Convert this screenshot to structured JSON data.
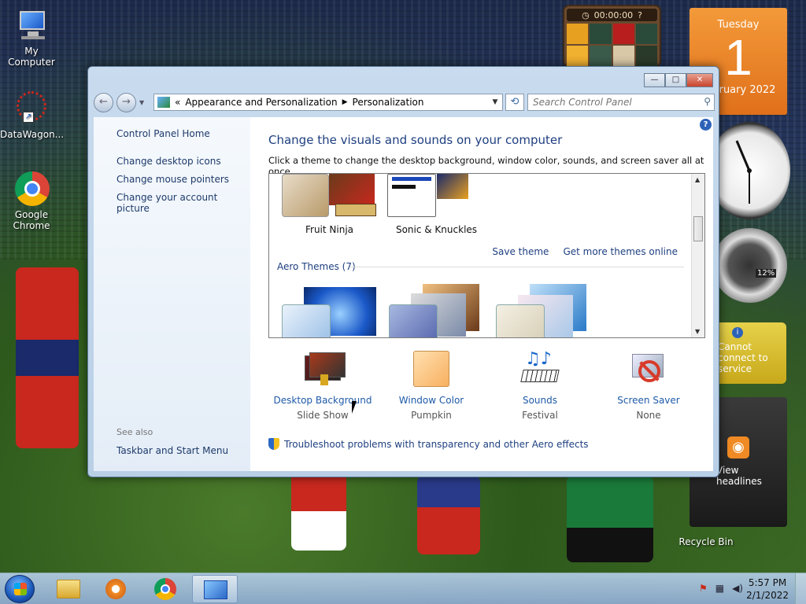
{
  "desktop": {
    "icons": [
      {
        "label": "My Computer"
      },
      {
        "label": "DataWagon..."
      },
      {
        "label": "Google Chrome"
      },
      {
        "label": "Recycle Bin"
      }
    ]
  },
  "gadgets": {
    "puzzle_timer": "00:00:00",
    "calendar": {
      "weekday": "Tuesday",
      "day": "1",
      "month_year": "February 2022"
    },
    "cpu_meter": {
      "value": "12%"
    },
    "weather": {
      "message": "Cannot connect to service"
    },
    "feed": {
      "label": "View headlines"
    }
  },
  "window": {
    "breadcrumb": [
      "Appearance and Personalization",
      "Personalization"
    ],
    "search_placeholder": "Search Control Panel",
    "sidebar": {
      "home": "Control Panel Home",
      "links": [
        "Change desktop icons",
        "Change mouse pointers",
        "Change your account picture"
      ],
      "see_also": "See also",
      "see_also_links": [
        "Taskbar and Start Menu"
      ]
    },
    "title": "Change the visuals and sounds on your computer",
    "description": "Click a theme to change the desktop background, window color, sounds, and screen saver all at once.",
    "themes": {
      "my_themes": [
        {
          "name": "Fruit Ninja"
        },
        {
          "name": "Sonic & Knuckles"
        }
      ],
      "save_theme": "Save theme",
      "get_more": "Get more themes online",
      "aero_header": "Aero Themes (7)"
    },
    "settings": [
      {
        "label": "Desktop Background",
        "value": "Slide Show",
        "icon": "desktop-background-icon"
      },
      {
        "label": "Window Color",
        "value": "Pumpkin",
        "icon": "window-color-icon"
      },
      {
        "label": "Sounds",
        "value": "Festival",
        "icon": "sounds-icon"
      },
      {
        "label": "Screen Saver",
        "value": "None",
        "icon": "screen-saver-icon"
      }
    ],
    "troubleshoot": "Troubleshoot problems with transparency and other Aero effects"
  },
  "taskbar": {
    "time": "5:57 PM",
    "date": "2/1/2022"
  }
}
